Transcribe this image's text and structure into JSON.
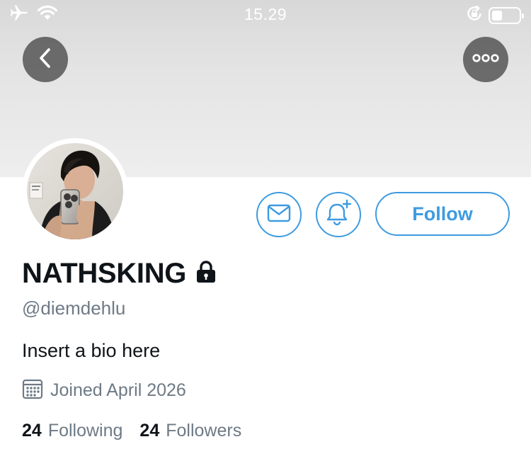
{
  "status_bar": {
    "time": "15.29",
    "icons": [
      "airplane-icon",
      "wifi-icon",
      "rotation-lock-icon",
      "battery-icon"
    ]
  },
  "header": {
    "back_icon": "chevron-left-icon",
    "more_icon": "ellipsis-icon"
  },
  "profile": {
    "display_name": "NATHSKING",
    "protected_icon": "lock-icon",
    "handle": "@diemdehlu",
    "bio": "Insert a bio here",
    "joined": "Joined April 2026",
    "following_count": "24",
    "following_label": "Following",
    "followers_count": "24",
    "followers_label": "Followers"
  },
  "actions": {
    "message_icon": "envelope-icon",
    "notify_icon": "bell-plus-icon",
    "follow_label": "Follow"
  },
  "colors": {
    "accent": "#3e9be0",
    "text_primary": "#0f1419",
    "text_secondary": "#6e7a85"
  }
}
